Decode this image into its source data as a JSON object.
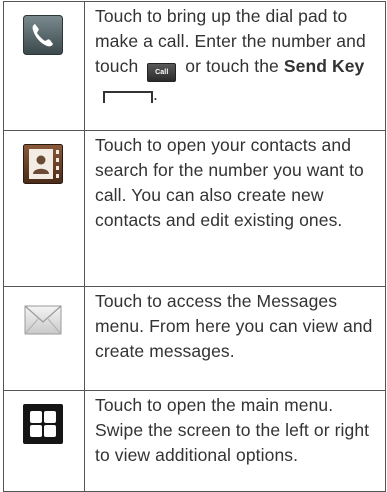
{
  "rows": [
    {
      "icon": "phone-icon",
      "text_a": "Touch to bring up the dial pad to make a call. Enter the number and touch",
      "call_chip": "Call",
      "text_b": "or touch the",
      "send_key": "Send Key",
      "text_c": "."
    },
    {
      "icon": "contacts-icon",
      "text": "Touch to open your contacts and search for the number you want to call. You can also create new contacts and edit existing ones."
    },
    {
      "icon": "envelope-icon",
      "text": "Touch to access the Messages menu. From here you can view and create messages."
    },
    {
      "icon": "app-grid-icon",
      "text": "Touch to open the main menu. Swipe the screen to the left or right to view additional options."
    }
  ],
  "colors": {
    "border": "#555555",
    "text": "#333333"
  }
}
